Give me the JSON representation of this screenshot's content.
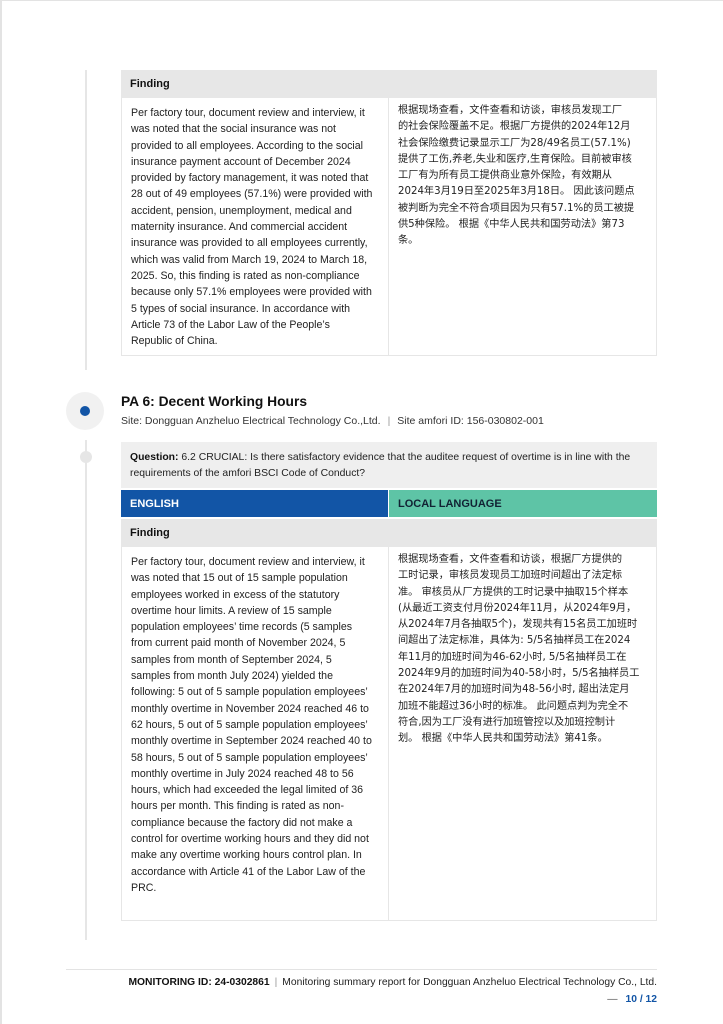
{
  "finding_table_1": {
    "header": "Finding",
    "english_text": "Per factory tour, document review and interview, it\nwas noted that the social insurance was not\nprovided to all employees. According to the social\ninsurance payment account of December 2024\nprovided by factory management, it was noted that\n28 out of 49 employees (57.1%) were provided with\naccident, pension, unemployment, medical and\nmaternity insurance. And commercial accident\ninsurance was provided to all employees currently,\nwhich was valid from March 19, 2024 to March 18,\n2025. So, this finding is rated as non-compliance\nbecause only 57.1% employees were provided with\n5 types of social insurance. In accordance with\nArticle 73 of the Labor Law of the People’s\nRepublic of China.",
    "local_text": "根据现场查看，文件查看和访谈，审核员发现工厂\n的社会保险覆盖不足。根据厂方提供的2024年12月\n社会保险缴费记录显示工厂为28/49名员工(57.1%)\n提供了工伤,养老,失业和医疗,生育保险。目前被审核\n工厂有为所有员工提供商业意外保险，有效期从\n2024年3月19日至2025年3月18日。 因此该问题点\n被判断为完全不符合项目因为只有57.1%的员工被提\n供5种保险。 根据《中华人民共和国劳动法》第73\n条。"
  },
  "section": {
    "title": "PA 6: Decent Working Hours",
    "site_label": "Site: Dongguan Anzheluo Electrical Technology Co.,Ltd.",
    "separator": "|",
    "site_id": "Site amfori ID: 156-030802-001"
  },
  "question": {
    "label": "Question:",
    "text": "6.2 CRUCIAL: Is there satisfactory evidence that the auditee request of overtime is in line with the requirements of the amfori BSCI Code of Conduct?"
  },
  "language_headers": {
    "english": "ENGLISH",
    "local": "LOCAL LANGUAGE"
  },
  "finding_table_2": {
    "header": "Finding",
    "english_text": "Per factory tour, document review and interview, it\nwas noted that 15 out of 15 sample population\nemployees worked in excess of the statutory\novertime hour limits. A review of 15 sample\npopulation employees’ time records (5 samples\nfrom current paid month of November 2024, 5\nsamples from month of September 2024, 5\nsamples from month July 2024) yielded the\nfollowing: 5 out of 5 sample population employees’\nmonthly overtime in November 2024 reached 46 to\n62 hours, 5 out of 5 sample population employees’\nmonthly overtime in September 2024 reached 40 to\n58 hours, 5 out of 5 sample population employees’\nmonthly overtime in July 2024 reached 48 to 56\nhours, which had exceeded the legal limited of 36\nhours per month. This finding is rated as non-\ncompliance because the factory did not make a\ncontrol for overtime working hours and they did not\nmake any overtime working hours control plan. In\naccordance with Article 41 of the Labor Law of the\nPRC.",
    "local_text": "根据现场查看，文件查看和访谈，根据厂方提供的\n工时记录，审核员发现员工加班时间超出了法定标\n准。 审核员从厂方提供的工时记录中抽取15个样本\n(从最近工资支付月份2024年11月，从2024年9月，\n从2024年7月各抽取5个)，发现共有15名员工加班时\n间超出了法定标准，具体为: 5/5名抽样员工在2024\n年11月的加班时间为46-62小时, 5/5名抽样员工在\n2024年9月的加班时间为40-58小时，5/5名抽样员工\n在2024年7月的加班时间为48-56小时, 超出法定月\n加班不能超过36小时的标准。 此问题点判为完全不\n符合,因为工厂没有进行加班管控以及加班控制计\n划。 根据《中华人民共和国劳动法》第41条。"
  },
  "footer": {
    "monitoring_id": "MONITORING ID: 24-0302861",
    "separator": "|",
    "report_title": "Monitoring summary report for Dongguan Anzheluo Electrical Technology Co., Ltd.",
    "dash": "—",
    "page": "10 / 12"
  }
}
